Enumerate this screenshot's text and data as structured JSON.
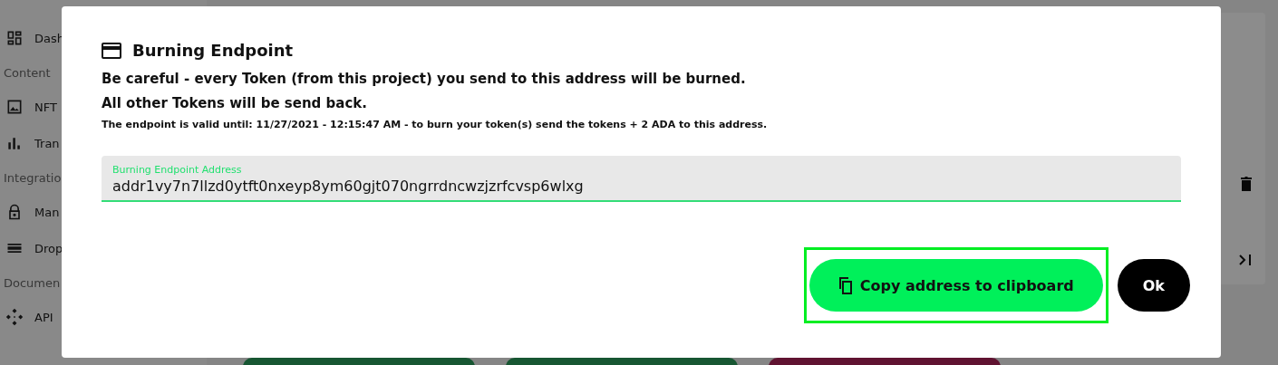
{
  "sidebar": {
    "items": [
      {
        "kind": "item",
        "label": "Dash"
      },
      {
        "kind": "section",
        "label": "Content"
      },
      {
        "kind": "item",
        "label": "NFT"
      },
      {
        "kind": "item",
        "label": "Tran"
      },
      {
        "kind": "section",
        "label": "Integratio"
      },
      {
        "kind": "item",
        "label": "Man"
      },
      {
        "kind": "item",
        "label": "Drop"
      },
      {
        "kind": "section",
        "label": "Documen"
      },
      {
        "kind": "item",
        "label": "API"
      }
    ]
  },
  "dialog": {
    "title": "Burning Endpoint",
    "warning": "Be careful - every Token (from this project) you send to this address will be burned.",
    "note": "All other Tokens will be send back.",
    "validity": "The endpoint is valid until: 11/27/2021 - 12:15:47 AM - to burn your token(s) send the tokens + 2 ADA to this address.",
    "field": {
      "label": "Burning Endpoint Address",
      "value": "addr1vy7n7llzd0ytft0nxeyp8ym60gjt070ngrrdncwzjzrfcvsp6wlxg"
    },
    "buttons": [
      {
        "kind": "copy",
        "label": "Copy address to clipboard",
        "focused": true
      },
      {
        "kind": "ok",
        "label": "Ok",
        "focused": false
      }
    ]
  }
}
